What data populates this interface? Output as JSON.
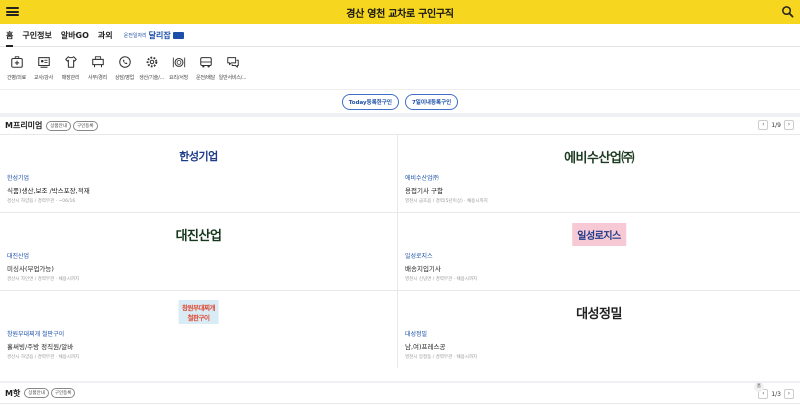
{
  "header": {
    "title": "경산 영천 교차로 구인구직"
  },
  "nav": {
    "tabs": [
      "홈",
      "구인정보",
      "알바GO",
      "과외"
    ],
    "promo_small": "운전일자리",
    "promo_big": "달리잡"
  },
  "categories": [
    {
      "label": "간병/의료",
      "icon": "medical-bag-icon"
    },
    {
      "label": "교사/강사",
      "icon": "teacher-icon"
    },
    {
      "label": "매장관리",
      "icon": "shirt-icon"
    },
    {
      "label": "사무/경리",
      "icon": "office-icon"
    },
    {
      "label": "상담/영업",
      "icon": "phone-chat-icon"
    },
    {
      "label": "생산/기술/...",
      "icon": "gear-icon"
    },
    {
      "label": "요리/서빙",
      "icon": "dish-icon"
    },
    {
      "label": "운전/배달",
      "icon": "truck-icon"
    },
    {
      "label": "일반서비스/...",
      "icon": "chat-bubble-icon"
    }
  ],
  "quick": [
    "Today등록한구인",
    "7일이내등록구인"
  ],
  "premium": {
    "title": "M프리미엄",
    "chips": [
      "상품안내",
      "구인등록"
    ],
    "page": "1/9",
    "cards": [
      {
        "logo": "한성기업",
        "company": "한성기업",
        "job": "식품)생산,보조 /박스포장,적재",
        "meta": "경산시 하양읍 / 경력무관 · ~06/16",
        "logo_color": "#1f3c8a"
      },
      {
        "logo": "에비수산업㈜",
        "company": "에비수산업㈜",
        "job": "용접기사 구함",
        "meta": "영천시 금호읍 / 경력(5년이상) · 채용시까지",
        "logo_color": "#1c3b22"
      },
      {
        "logo": "대진산업",
        "company": "대진산업",
        "job": "미싱사(부업가능)",
        "meta": "경산시 자인면 / 경력무관 · 채용시까지",
        "logo_color": "#16361b"
      },
      {
        "logo": "일성로지스",
        "company": "일성로지스",
        "job": "배송지입기사",
        "meta": "영천시 신녕면 / 경력무관 · 채용시까지",
        "logo_color": "#1e3a8a"
      },
      {
        "logo_top": "창원부대찌개",
        "logo_bottom": "철판구이",
        "company": "창원부대찌개 철판구이",
        "job": "홀써빙/주방 정직원/알바",
        "meta": "경산시 하양읍 / 경력무관 · 채용시까지",
        "logo_color": "#e0472f"
      },
      {
        "logo": "대성정밀",
        "company": "대성정밀",
        "job": "남,여)프레스공",
        "meta": "영천시 망정동 / 경력무관 · 채용시까지",
        "logo_color": "#222222"
      }
    ]
  },
  "hot": {
    "title": "M핫",
    "chips": [
      "상품안내",
      "구인등록"
    ],
    "page": "1/3",
    "home_label": "홈"
  }
}
